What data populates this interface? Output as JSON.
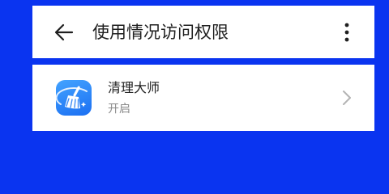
{
  "header": {
    "title": "使用情况访问权限",
    "back_icon": "arrow-left-icon",
    "more_icon": "more-vertical-icon"
  },
  "apps": [
    {
      "name": "清理大师",
      "status": "开启",
      "icon": "broom-cleaner-icon"
    }
  ],
  "colors": {
    "background": "#0a34f0",
    "card": "#ffffff",
    "title_text": "#1f1f1f",
    "secondary_text": "#8a8a8a",
    "app_icon_blue": "#1b6ff2"
  }
}
